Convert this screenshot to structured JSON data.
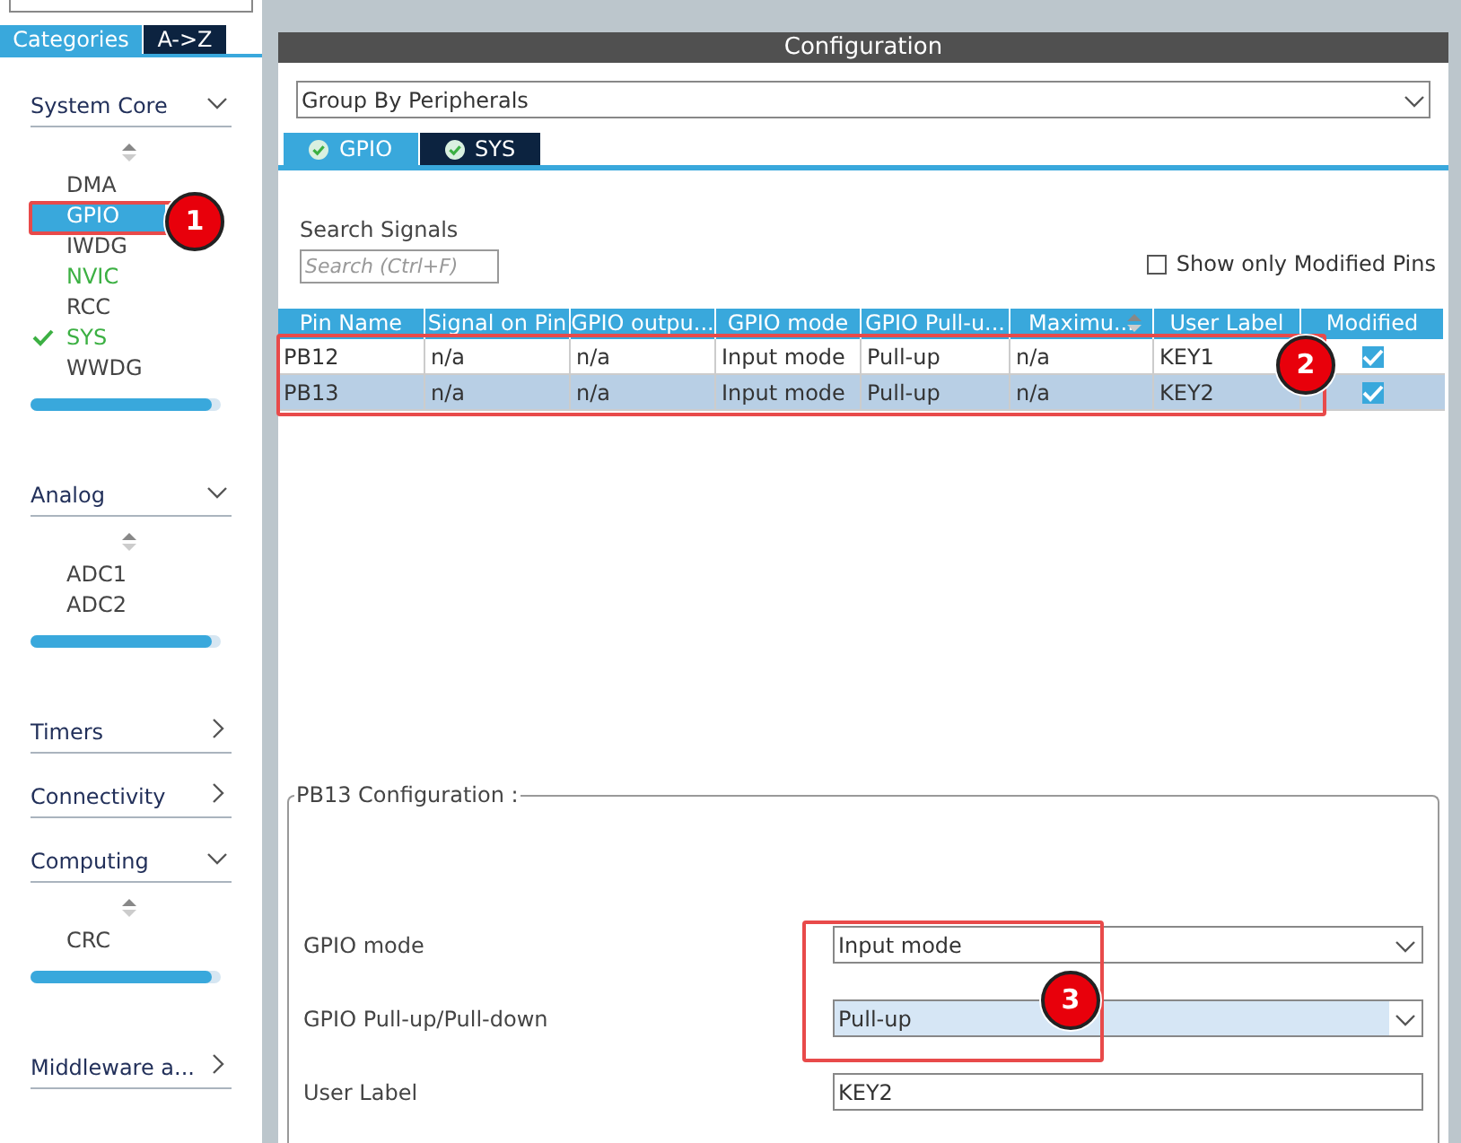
{
  "sidebar": {
    "tabs": [
      {
        "label": "Categories",
        "selected": true
      },
      {
        "label": "A->Z",
        "selected": false
      }
    ],
    "groups": [
      {
        "title": "System Core",
        "expanded": true,
        "items": [
          {
            "label": "DMA",
            "selected": false,
            "configured": false,
            "checked": false
          },
          {
            "label": "GPIO",
            "selected": true,
            "configured": false,
            "checked": false
          },
          {
            "label": "IWDG",
            "selected": false,
            "configured": false,
            "checked": false
          },
          {
            "label": "NVIC",
            "selected": false,
            "configured": true,
            "checked": false
          },
          {
            "label": "RCC",
            "selected": false,
            "configured": false,
            "checked": false
          },
          {
            "label": "SYS",
            "selected": false,
            "configured": true,
            "checked": true
          },
          {
            "label": "WWDG",
            "selected": false,
            "configured": false,
            "checked": false
          }
        ]
      },
      {
        "title": "Analog",
        "expanded": true,
        "items": [
          {
            "label": "ADC1",
            "selected": false,
            "configured": false,
            "checked": false
          },
          {
            "label": "ADC2",
            "selected": false,
            "configured": false,
            "checked": false
          }
        ]
      },
      {
        "title": "Timers",
        "expanded": false
      },
      {
        "title": "Connectivity",
        "expanded": false
      },
      {
        "title": "Computing",
        "expanded": true,
        "items": [
          {
            "label": "CRC",
            "selected": false,
            "configured": false,
            "checked": false
          }
        ]
      },
      {
        "title": "Middleware a...",
        "expanded": false
      }
    ]
  },
  "configuration": {
    "title": "Configuration",
    "group_by": "Group By Peripherals",
    "tabs": [
      {
        "label": "GPIO",
        "selected": true
      },
      {
        "label": "SYS",
        "selected": false
      }
    ],
    "search_label": "Search Signals",
    "search": {
      "placeholder": "Search (Ctrl+F)"
    },
    "show_only_modified": {
      "label": "Show only Modified Pins",
      "checked": false
    },
    "table": {
      "columns": [
        "Pin Name",
        "Signal on Pin",
        "GPIO outpu...",
        "GPIO mode",
        "GPIO Pull-u...",
        "Maximu...",
        "User Label",
        "Modified"
      ],
      "rows": [
        {
          "cells": [
            "PB12",
            "n/a",
            "n/a",
            "Input mode",
            "Pull-up",
            "n/a",
            "KEY1"
          ],
          "modified": true,
          "selected": false
        },
        {
          "cells": [
            "PB13",
            "n/a",
            "n/a",
            "Input mode",
            "Pull-up",
            "n/a",
            "KEY2"
          ],
          "modified": true,
          "selected": true
        }
      ]
    },
    "pin_config": {
      "title": "PB13 Configuration :",
      "fields": [
        {
          "label": "GPIO mode",
          "value": "Input mode",
          "kind": "dropdown",
          "selected": false
        },
        {
          "label": "GPIO Pull-up/Pull-down",
          "value": "Pull-up",
          "kind": "dropdown",
          "selected": true
        },
        {
          "label": "User Label",
          "value": "KEY2",
          "kind": "text",
          "selected": false
        }
      ]
    }
  },
  "callouts": [
    "1",
    "2",
    "3"
  ]
}
